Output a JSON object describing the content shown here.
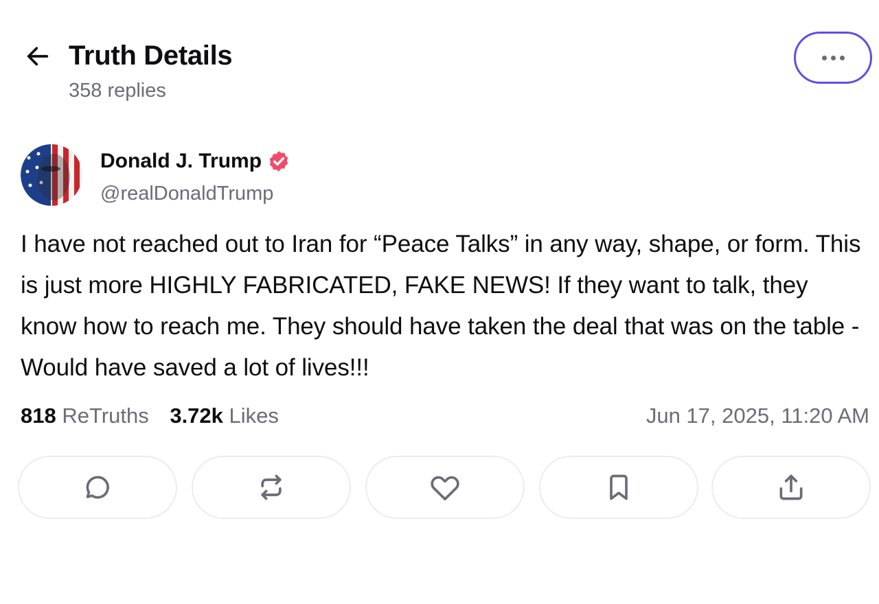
{
  "header": {
    "title": "Truth Details",
    "replies": "358 replies",
    "back_icon": "arrow-left-icon",
    "more_icon": "more-horizontal-icon",
    "focus_ring_color": "#5d4fe0"
  },
  "author": {
    "name": "Donald J. Trump",
    "handle": "@realDonaldTrump",
    "verified_icon": "verified-badge-icon",
    "verified_color": "#ef4b6b"
  },
  "post": {
    "text": "I have not reached out to Iran for “Peace Talks” in any way, shape, or form. This is just more HIGHLY FABRICATED, FAKE NEWS! If they want to talk, they know how to reach me. They should have taken the deal that was on the table - Would have saved a lot of lives!!!"
  },
  "stats": {
    "retruths_count": "818",
    "retruths_label": "ReTruths",
    "likes_count": "3.72k",
    "likes_label": "Likes",
    "timestamp": "Jun 17, 2025, 11:20 AM"
  },
  "actions": [
    {
      "name": "reply",
      "icon": "comment-icon"
    },
    {
      "name": "retruth",
      "icon": "repost-icon"
    },
    {
      "name": "like",
      "icon": "heart-icon"
    },
    {
      "name": "bookmark",
      "icon": "bookmark-icon"
    },
    {
      "name": "share",
      "icon": "share-icon"
    }
  ]
}
